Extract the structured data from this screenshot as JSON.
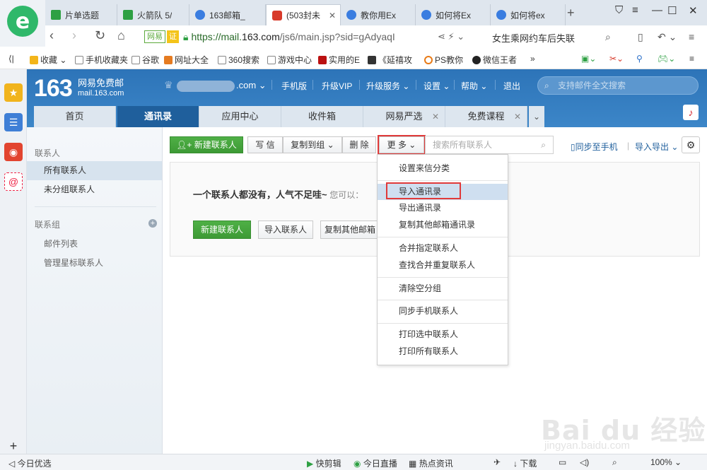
{
  "browser": {
    "tabs": [
      {
        "label": "片单选题",
        "icon": "green"
      },
      {
        "label": "火箭队 5/",
        "icon": "green"
      },
      {
        "label": "163邮箱_",
        "icon": "paw"
      },
      {
        "label": "(503封未",
        "icon": "red"
      },
      {
        "label": "教你用Ex",
        "icon": "paw"
      },
      {
        "label": "如何将Ex",
        "icon": "paw"
      },
      {
        "label": "如何将ex",
        "icon": "paw"
      }
    ],
    "url_badge1": "网易",
    "url_badge2": "证",
    "url_host_pre": "https://mail.",
    "url_host_bold": "163.com",
    "url_path": "/js6/main.jsp?sid=gAdyaqI",
    "search_text": "女生乘网约车后失联",
    "bookmarks": [
      "收藏",
      "手机收藏夹",
      "谷歌",
      "网址大全",
      "360搜索",
      "游戏中心",
      "实用的E",
      "《延禧攻",
      "PS教你",
      "微信王者"
    ],
    "bookmarks_more": "»",
    "status": {
      "left": "今日优选",
      "items": [
        "快剪辑",
        "今日直播",
        "热点资讯",
        "下载"
      ],
      "zoom": "100%"
    }
  },
  "mail": {
    "brand_num": "163",
    "brand_name": "网易免费邮",
    "brand_domain": "mail.163.com",
    "account_domain": ".com",
    "header_links": [
      "手机版",
      "升级VIP",
      "升级服务",
      "设置",
      "帮助",
      "退出"
    ],
    "search_placeholder": "支持邮件全文搜索",
    "tabs": [
      "首页",
      "通讯录",
      "应用中心",
      "收件箱",
      "网易严选",
      "免费课程"
    ],
    "active_tab": "通讯录"
  },
  "contacts": {
    "sidebar": {
      "section1": "联系人",
      "items": [
        "所有联系人",
        "未分组联系人"
      ],
      "section2": "联系组",
      "sub_items": [
        "邮件列表",
        "管理星标联系人"
      ]
    },
    "toolbar": {
      "new_contact": "新建联系人",
      "write": "写 信",
      "copy_to_group": "复制到组",
      "delete": "删 除",
      "more": "更 多",
      "search_placeholder": "搜索所有联系人",
      "sync_phone": "同步至手机",
      "import_export": "导入导出"
    },
    "empty": {
      "message": "一个联系人都没有，人气不足哇~",
      "hint": "您可以：",
      "btn_new": "新建联系人",
      "btn_import": "导入联系人",
      "btn_copy": "复制其他邮箱"
    },
    "more_menu": [
      {
        "label": "设置来信分类"
      },
      {
        "label": "导入通讯录",
        "highlight": true
      },
      {
        "label": "导出通讯录"
      },
      {
        "label": "复制其他邮箱通讯录"
      },
      {
        "label": "合并指定联系人"
      },
      {
        "label": "查找合并重复联系人"
      },
      {
        "label": "清除空分组"
      },
      {
        "label": "同步手机联系人"
      },
      {
        "label": "打印选中联系人"
      },
      {
        "label": "打印所有联系人"
      }
    ]
  },
  "watermark": {
    "brand": "Bai du 经验",
    "url": "jingyan.baidu.com"
  },
  "colors": {
    "accent": "#1f5f9c",
    "green": "#3d9a35",
    "highlight_box": "#e03a3a",
    "menu_highlight": "#cfdff0"
  }
}
